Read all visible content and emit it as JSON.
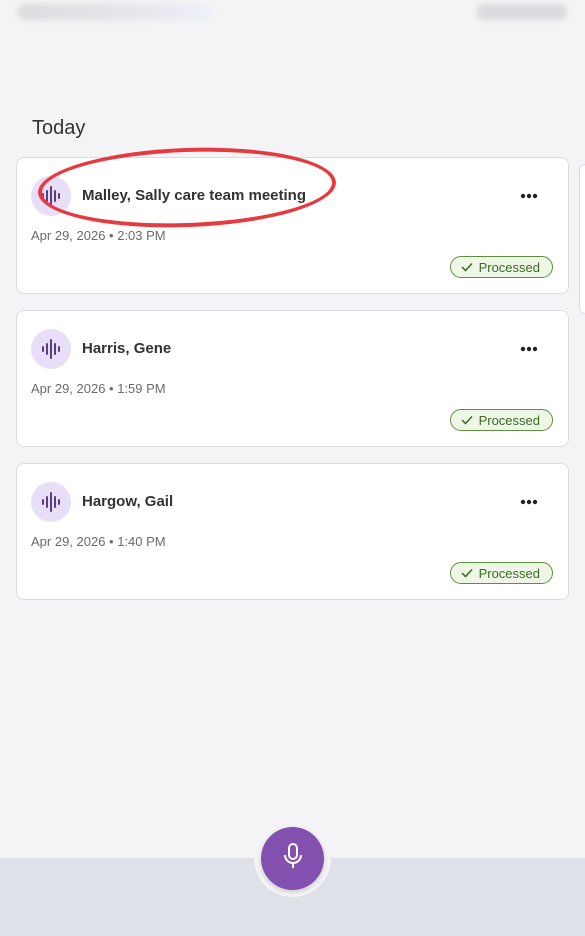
{
  "section": {
    "title": "Today"
  },
  "recordings": [
    {
      "title": "Malley, Sally care team meeting",
      "meta": "Apr 29, 2026 • 2:03 PM",
      "status": "Processed",
      "icon": "waveform-icon"
    },
    {
      "title": "Harris, Gene",
      "meta": "Apr 29, 2026 • 1:59 PM",
      "status": "Processed",
      "icon": "waveform-icon"
    },
    {
      "title": "Hargow, Gail",
      "meta": "Apr 29, 2026 • 1:40 PM",
      "status": "Processed",
      "icon": "waveform-icon"
    }
  ],
  "record_button": {
    "icon": "microphone-icon"
  },
  "colors": {
    "accent": "#8450b0",
    "icon_bg": "#e8def8",
    "status_green": "#5e8f3e",
    "highlight_red": "#e53a40"
  }
}
